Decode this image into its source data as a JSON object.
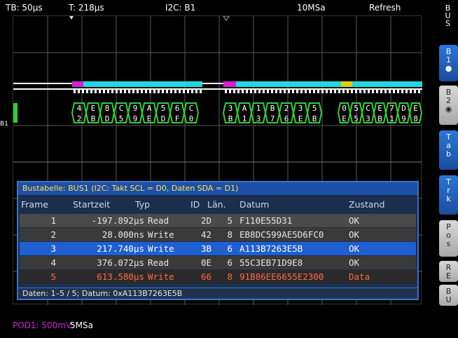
{
  "topbar": {
    "timebase": "TB: 50µs",
    "trigger_time": "T: 218µs",
    "bus": "I2C: B1",
    "sample_rate": "10MSa",
    "mode": "Refresh"
  },
  "sidebar": {
    "header": "BUS",
    "buttons": [
      {
        "label": "B1",
        "active": true
      },
      {
        "label": "B2",
        "active": false
      },
      {
        "label": "Tab",
        "active": true
      },
      {
        "label": "Trk",
        "active": true
      },
      {
        "label": "Pos",
        "active": false
      },
      {
        "label": "RE",
        "active": false
      },
      {
        "label": "BU",
        "active": false
      }
    ]
  },
  "channel_marker": "B1",
  "waveform": {
    "group1_top": [
      "4",
      "E",
      "8",
      "C",
      "9",
      "A",
      "5",
      "6",
      "C"
    ],
    "group1_bottom": [
      "2",
      "B",
      "D",
      "5",
      "9",
      "E",
      "D",
      "F",
      "0"
    ],
    "group2_top": [
      "3",
      "A",
      "1",
      "B",
      "2",
      "3",
      "5"
    ],
    "group2_bottom": [
      "B",
      "1",
      "3",
      "7",
      "6",
      "E",
      "B"
    ],
    "group3_top": [
      "0",
      "5",
      "C",
      "E",
      "7",
      "D",
      "E"
    ],
    "group3_bottom": [
      "E",
      "5",
      "3",
      "B",
      "1",
      "9",
      "8"
    ]
  },
  "bus_table": {
    "title": "Bustabelle: BUS1 (I2C: Takt SCL = D0, Daten SDA = D1)",
    "columns": {
      "frame": "Frame",
      "start": "Startzeit",
      "typ": "Typ",
      "id": "ID",
      "len": "Län.",
      "datum": "Datum",
      "zustand": "Zustand"
    },
    "rows": [
      {
        "frame": "1",
        "start": "-197.892µs",
        "typ": "Read",
        "id": "2D",
        "len": "5",
        "datum": "F110E55D31",
        "zustand": "OK"
      },
      {
        "frame": "2",
        "start": "28.000ns",
        "typ": "Write",
        "id": "42",
        "len": "8",
        "datum": "EB8DC599AE5D6FC0",
        "zustand": "OK"
      },
      {
        "frame": "3",
        "start": "217.740µs",
        "typ": "Write",
        "id": "3B",
        "len": "6",
        "datum": "A113B7263E5B",
        "zustand": "OK"
      },
      {
        "frame": "4",
        "start": "376.072µs",
        "typ": "Read",
        "id": "0E",
        "len": "6",
        "datum": "55C3EB71D9E8",
        "zustand": "OK"
      },
      {
        "frame": "5",
        "start": "613.580µs",
        "typ": "Write",
        "id": "66",
        "len": "8",
        "datum": "91B86EE6655E2300",
        "zustand": "Data"
      }
    ],
    "footer": "Daten: 1–5 / 5; Datum: 0xA113B7263E5B"
  },
  "bottom": {
    "pod": "POD1: 500mV",
    "sample_rate": "5MSa"
  },
  "colors": {
    "grid": "#5a5a5a",
    "accent_blue": "#2a6fd6",
    "selected_row": "#1f5fd0",
    "error_row": "#ff6a3d",
    "magenta": "#d020d0",
    "cyan": "#22d8e0",
    "green": "#30d030",
    "yellow": "#e0d000"
  }
}
